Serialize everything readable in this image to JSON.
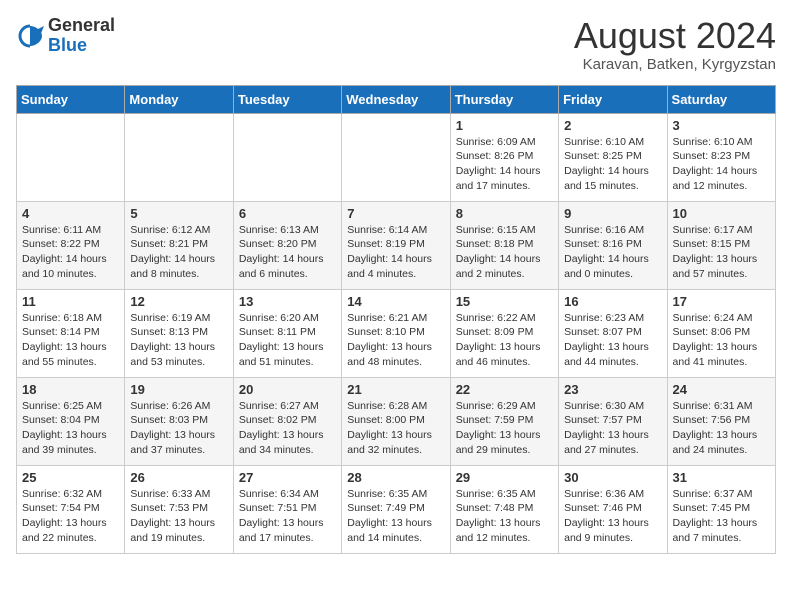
{
  "logo": {
    "general": "General",
    "blue": "Blue"
  },
  "title": {
    "month_year": "August 2024",
    "location": "Karavan, Batken, Kyrgyzstan"
  },
  "days_of_week": [
    "Sunday",
    "Monday",
    "Tuesday",
    "Wednesday",
    "Thursday",
    "Friday",
    "Saturday"
  ],
  "weeks": [
    [
      {
        "day": "",
        "info": ""
      },
      {
        "day": "",
        "info": ""
      },
      {
        "day": "",
        "info": ""
      },
      {
        "day": "",
        "info": ""
      },
      {
        "day": "1",
        "sunrise": "6:09 AM",
        "sunset": "8:26 PM",
        "daylight": "14 hours and 17 minutes."
      },
      {
        "day": "2",
        "sunrise": "6:10 AM",
        "sunset": "8:25 PM",
        "daylight": "14 hours and 15 minutes."
      },
      {
        "day": "3",
        "sunrise": "6:10 AM",
        "sunset": "8:23 PM",
        "daylight": "14 hours and 12 minutes."
      }
    ],
    [
      {
        "day": "4",
        "sunrise": "6:11 AM",
        "sunset": "8:22 PM",
        "daylight": "14 hours and 10 minutes."
      },
      {
        "day": "5",
        "sunrise": "6:12 AM",
        "sunset": "8:21 PM",
        "daylight": "14 hours and 8 minutes."
      },
      {
        "day": "6",
        "sunrise": "6:13 AM",
        "sunset": "8:20 PM",
        "daylight": "14 hours and 6 minutes."
      },
      {
        "day": "7",
        "sunrise": "6:14 AM",
        "sunset": "8:19 PM",
        "daylight": "14 hours and 4 minutes."
      },
      {
        "day": "8",
        "sunrise": "6:15 AM",
        "sunset": "8:18 PM",
        "daylight": "14 hours and 2 minutes."
      },
      {
        "day": "9",
        "sunrise": "6:16 AM",
        "sunset": "8:16 PM",
        "daylight": "14 hours and 0 minutes."
      },
      {
        "day": "10",
        "sunrise": "6:17 AM",
        "sunset": "8:15 PM",
        "daylight": "13 hours and 57 minutes."
      }
    ],
    [
      {
        "day": "11",
        "sunrise": "6:18 AM",
        "sunset": "8:14 PM",
        "daylight": "13 hours and 55 minutes."
      },
      {
        "day": "12",
        "sunrise": "6:19 AM",
        "sunset": "8:13 PM",
        "daylight": "13 hours and 53 minutes."
      },
      {
        "day": "13",
        "sunrise": "6:20 AM",
        "sunset": "8:11 PM",
        "daylight": "13 hours and 51 minutes."
      },
      {
        "day": "14",
        "sunrise": "6:21 AM",
        "sunset": "8:10 PM",
        "daylight": "13 hours and 48 minutes."
      },
      {
        "day": "15",
        "sunrise": "6:22 AM",
        "sunset": "8:09 PM",
        "daylight": "13 hours and 46 minutes."
      },
      {
        "day": "16",
        "sunrise": "6:23 AM",
        "sunset": "8:07 PM",
        "daylight": "13 hours and 44 minutes."
      },
      {
        "day": "17",
        "sunrise": "6:24 AM",
        "sunset": "8:06 PM",
        "daylight": "13 hours and 41 minutes."
      }
    ],
    [
      {
        "day": "18",
        "sunrise": "6:25 AM",
        "sunset": "8:04 PM",
        "daylight": "13 hours and 39 minutes."
      },
      {
        "day": "19",
        "sunrise": "6:26 AM",
        "sunset": "8:03 PM",
        "daylight": "13 hours and 37 minutes."
      },
      {
        "day": "20",
        "sunrise": "6:27 AM",
        "sunset": "8:02 PM",
        "daylight": "13 hours and 34 minutes."
      },
      {
        "day": "21",
        "sunrise": "6:28 AM",
        "sunset": "8:00 PM",
        "daylight": "13 hours and 32 minutes."
      },
      {
        "day": "22",
        "sunrise": "6:29 AM",
        "sunset": "7:59 PM",
        "daylight": "13 hours and 29 minutes."
      },
      {
        "day": "23",
        "sunrise": "6:30 AM",
        "sunset": "7:57 PM",
        "daylight": "13 hours and 27 minutes."
      },
      {
        "day": "24",
        "sunrise": "6:31 AM",
        "sunset": "7:56 PM",
        "daylight": "13 hours and 24 minutes."
      }
    ],
    [
      {
        "day": "25",
        "sunrise": "6:32 AM",
        "sunset": "7:54 PM",
        "daylight": "13 hours and 22 minutes."
      },
      {
        "day": "26",
        "sunrise": "6:33 AM",
        "sunset": "7:53 PM",
        "daylight": "13 hours and 19 minutes."
      },
      {
        "day": "27",
        "sunrise": "6:34 AM",
        "sunset": "7:51 PM",
        "daylight": "13 hours and 17 minutes."
      },
      {
        "day": "28",
        "sunrise": "6:35 AM",
        "sunset": "7:49 PM",
        "daylight": "13 hours and 14 minutes."
      },
      {
        "day": "29",
        "sunrise": "6:35 AM",
        "sunset": "7:48 PM",
        "daylight": "13 hours and 12 minutes."
      },
      {
        "day": "30",
        "sunrise": "6:36 AM",
        "sunset": "7:46 PM",
        "daylight": "13 hours and 9 minutes."
      },
      {
        "day": "31",
        "sunrise": "6:37 AM",
        "sunset": "7:45 PM",
        "daylight": "13 hours and 7 minutes."
      }
    ]
  ],
  "labels": {
    "sunrise": "Sunrise:",
    "sunset": "Sunset:",
    "daylight": "Daylight:"
  }
}
